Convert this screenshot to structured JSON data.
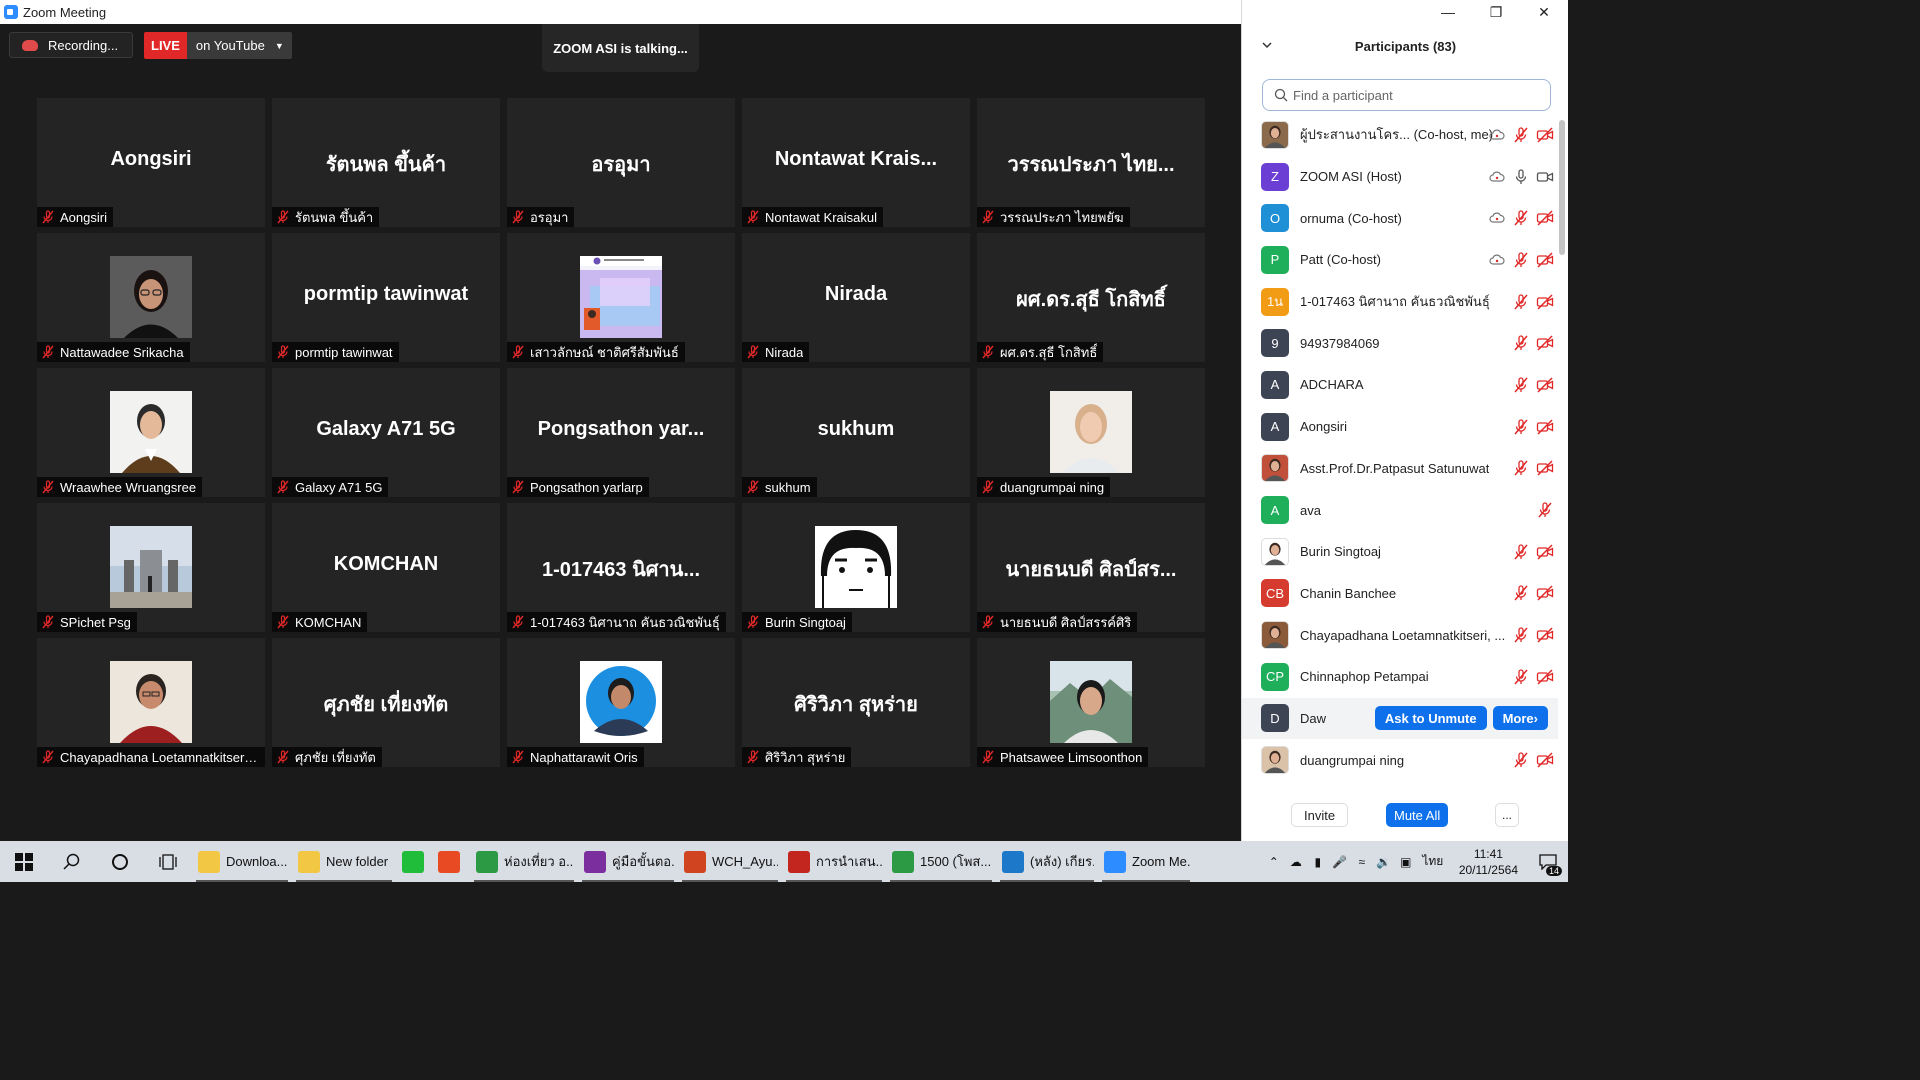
{
  "window": {
    "title": "Zoom Meeting"
  },
  "meeting": {
    "recording_label": "Recording...",
    "live_label": "LIVE",
    "live_target": "on YouTube",
    "talking": "ZOOM ASI is talking..."
  },
  "tiles": [
    {
      "display": "Aongsiri",
      "label": "Aongsiri",
      "type": "name"
    },
    {
      "display": "รัตนพล ขึ้นค้า",
      "label": "รัตนพล ขึ้นค้า",
      "type": "name"
    },
    {
      "display": "อรอุมา",
      "label": "อรอุมา",
      "type": "name"
    },
    {
      "display": "Nontawat  Krais...",
      "label": "Nontawat Kraisakul",
      "type": "name"
    },
    {
      "display": "วรรณประภา ไทย...",
      "label": "วรรณประภา ไทยพยัฆ",
      "type": "name"
    },
    {
      "display": "",
      "label": "Nattawadee Srikacha",
      "type": "photo",
      "photo": "woman-glasses"
    },
    {
      "display": "pormtip tawinwat",
      "label": "pormtip tawinwat",
      "type": "name"
    },
    {
      "display": "",
      "label": "เสาวลักษณ์ ชาติศรีสัมพันธ์",
      "type": "photo",
      "photo": "science-slide"
    },
    {
      "display": "Nirada",
      "label": "Nirada",
      "type": "name"
    },
    {
      "display": "ผศ.ดร.สุธี โกสิทธิ์",
      "label": "ผศ.ดร.สุธี โกสิทธิ์",
      "type": "name"
    },
    {
      "display": "",
      "label": "Wraawhee Wruangsree",
      "type": "photo",
      "photo": "man-portrait"
    },
    {
      "display": "Galaxy A71 5G",
      "label": "Galaxy A71 5G",
      "type": "name"
    },
    {
      "display": "Pongsathon  yar...",
      "label": "Pongsathon yarlarp",
      "type": "name"
    },
    {
      "display": "sukhum",
      "label": "sukhum",
      "type": "name"
    },
    {
      "display": "",
      "label": "duangrumpai ning",
      "type": "photo",
      "photo": "woman-light"
    },
    {
      "display": "",
      "label": "SPichet Psg",
      "type": "photo",
      "photo": "monument"
    },
    {
      "display": "KOMCHAN",
      "label": "KOMCHAN",
      "type": "name"
    },
    {
      "display": "1-017463 นิศาน...",
      "label": "1-017463 นิศานาถ คันธวณิชพันธุ์",
      "type": "name"
    },
    {
      "display": "",
      "label": "Burin Singtoaj",
      "type": "photo",
      "photo": "cartoon-face"
    },
    {
      "display": "นายธนบดี ศิลป์สร...",
      "label": "นายธนบดี ศิลป์สรรค์ศิริ",
      "type": "name"
    },
    {
      "display": "",
      "label": "Chayapadhana Loetamnatkitseri, ...",
      "type": "photo",
      "photo": "man-red"
    },
    {
      "display": "ศุภชัย เที่ยงทัต",
      "label": "ศุภชัย เที่ยงทัต",
      "type": "name"
    },
    {
      "display": "",
      "label": "Naphattarawit Oris",
      "type": "photo",
      "photo": "man-blue-circle"
    },
    {
      "display": "ศิริวิภา สุหร่าย",
      "label": "ศิริวิภา สุหร่าย",
      "type": "name"
    },
    {
      "display": "",
      "label": "Phatsawee Limsoonthon",
      "type": "photo",
      "photo": "man-outdoor"
    }
  ],
  "panel": {
    "title": "Participants (83)",
    "search_placeholder": "Find a participant",
    "participants": [
      {
        "name": "ผู้ประสานงานโคร... (Co-host, me)",
        "avatar": "photo",
        "avatar_color": "#8a6a4a",
        "initials": "",
        "cloud": true,
        "mic": "muted",
        "video": "off"
      },
      {
        "name": "ZOOM ASI (Host)",
        "avatar": "letter",
        "avatar_color": "#6b3fd4",
        "initials": "Z",
        "cloud": true,
        "mic": "on",
        "video": "on"
      },
      {
        "name": "ornuma (Co-host)",
        "avatar": "letter",
        "avatar_color": "#1f8fd6",
        "initials": "O",
        "cloud": true,
        "mic": "muted",
        "video": "off"
      },
      {
        "name": "Patt (Co-host)",
        "avatar": "letter",
        "avatar_color": "#1fae5a",
        "initials": "P",
        "cloud": true,
        "mic": "muted",
        "video": "off"
      },
      {
        "name": "1-017463 นิศานาถ คันธวณิชพันธุ์",
        "avatar": "letter",
        "avatar_color": "#f29b14",
        "initials": "1น",
        "cloud": false,
        "mic": "muted",
        "video": "off"
      },
      {
        "name": "94937984069",
        "avatar": "letter",
        "avatar_color": "#3d4454",
        "initials": "9",
        "cloud": false,
        "mic": "muted",
        "video": "off"
      },
      {
        "name": "ADCHARA",
        "avatar": "letter",
        "avatar_color": "#3d4454",
        "initials": "A",
        "cloud": false,
        "mic": "muted",
        "video": "off"
      },
      {
        "name": "Aongsiri",
        "avatar": "letter",
        "avatar_color": "#3d4454",
        "initials": "A",
        "cloud": false,
        "mic": "muted",
        "video": "off"
      },
      {
        "name": "Asst.Prof.Dr.Patpasut Satunuwat",
        "avatar": "photo",
        "avatar_color": "#c0503a",
        "initials": "",
        "cloud": false,
        "mic": "muted",
        "video": "off"
      },
      {
        "name": "ava",
        "avatar": "letter",
        "avatar_color": "#1fae5a",
        "initials": "A",
        "cloud": false,
        "mic": "muted",
        "video": "none"
      },
      {
        "name": "Burin Singtoaj",
        "avatar": "photo",
        "avatar_color": "#ffffff",
        "initials": "",
        "cloud": false,
        "mic": "muted",
        "video": "off"
      },
      {
        "name": "Chanin Banchee",
        "avatar": "letter",
        "avatar_color": "#d63b2f",
        "initials": "CB",
        "cloud": false,
        "mic": "muted",
        "video": "off"
      },
      {
        "name": "Chayapadhana Loetamnatkitseri, ...",
        "avatar": "photo",
        "avatar_color": "#8a5a3a",
        "initials": "",
        "cloud": false,
        "mic": "muted",
        "video": "off"
      },
      {
        "name": "Chinnaphop Petampai",
        "avatar": "letter",
        "avatar_color": "#1fae5a",
        "initials": "CP",
        "cloud": false,
        "mic": "muted",
        "video": "off"
      },
      {
        "name": "Daw",
        "avatar": "letter",
        "avatar_color": "#3d4454",
        "initials": "D",
        "cloud": false,
        "mic": "hover",
        "video": "hover",
        "hover": true
      },
      {
        "name": "duangrumpai ning",
        "avatar": "photo",
        "avatar_color": "#d9c2a8",
        "initials": "",
        "cloud": false,
        "mic": "muted",
        "video": "off"
      }
    ],
    "ask_unmute_label": "Ask to Unmute",
    "more_label": "More",
    "invite_label": "Invite",
    "mute_all_label": "Mute All",
    "overflow_label": "..."
  },
  "taskbar": {
    "apps": [
      {
        "label": "Downloa...",
        "icon_color": "#f2c744"
      },
      {
        "label": "New folder",
        "icon_color": "#f2c744"
      },
      {
        "label": "",
        "icon_color": "#1fbd3a"
      },
      {
        "label": "",
        "icon_color": "#e84a23"
      },
      {
        "label": "ห่องเที่ยว อ...",
        "icon_color": "#2c9a44"
      },
      {
        "label": "คู่มือขั้นตอ...",
        "icon_color": "#7b2e9e"
      },
      {
        "label": "WCH_Ayu...",
        "icon_color": "#d04420"
      },
      {
        "label": "การนำเสน...",
        "icon_color": "#c2261f"
      },
      {
        "label": "1500 (โพส...",
        "icon_color": "#2c9a44"
      },
      {
        "label": "(หลัง) เกียร...",
        "icon_color": "#1d78c9"
      },
      {
        "label": "Zoom Me...",
        "icon_color": "#2d8cff"
      }
    ],
    "language": "ไทย",
    "time": "11:41",
    "date": "20/11/2564",
    "notification_count": "14"
  }
}
